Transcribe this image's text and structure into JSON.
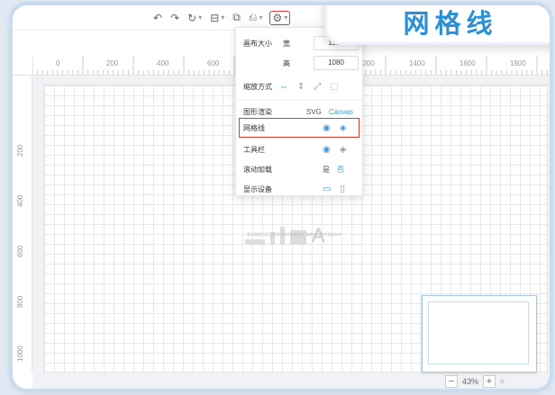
{
  "toolbar": {
    "items": [
      {
        "name": "undo-icon",
        "glyph": "↶"
      },
      {
        "name": "redo-icon",
        "glyph": "↷"
      },
      {
        "name": "rotate-icon",
        "glyph": "↻"
      },
      {
        "name": "save-icon",
        "glyph": "⊟"
      },
      {
        "name": "copy-icon",
        "glyph": "⧉"
      },
      {
        "name": "share-icon",
        "glyph": "⎌"
      },
      {
        "name": "gear-icon",
        "glyph": "⚙"
      }
    ]
  },
  "banner": {
    "title": "网格线"
  },
  "ruler": {
    "top_labels": [
      "0",
      "200",
      "400",
      "600",
      "1200",
      "1400",
      "1600",
      "1800"
    ],
    "left_labels": [
      "200",
      "400",
      "600",
      "800",
      "1000"
    ]
  },
  "settings_dropdown": {
    "canvas_size_label": "画布大小",
    "width_label": "宽",
    "width_value": "1920",
    "height_label": "高",
    "height_value": "1080",
    "scale_label": "缩放方式",
    "render_label": "图形渲染",
    "render_options": [
      "SVG",
      "Canvas"
    ],
    "gridline_label": "网格线",
    "toolbar_label": "工具栏",
    "scroll_label": "滚动加载",
    "scroll_options": [
      "是",
      "否"
    ],
    "display_label": "显示设备"
  },
  "zoom": {
    "minus": "−",
    "level": "43%",
    "plus": "+"
  },
  "placeholder_caption": "暂无数据可显示请添加组件到画布中 拖拽左侧组件到画布中"
}
